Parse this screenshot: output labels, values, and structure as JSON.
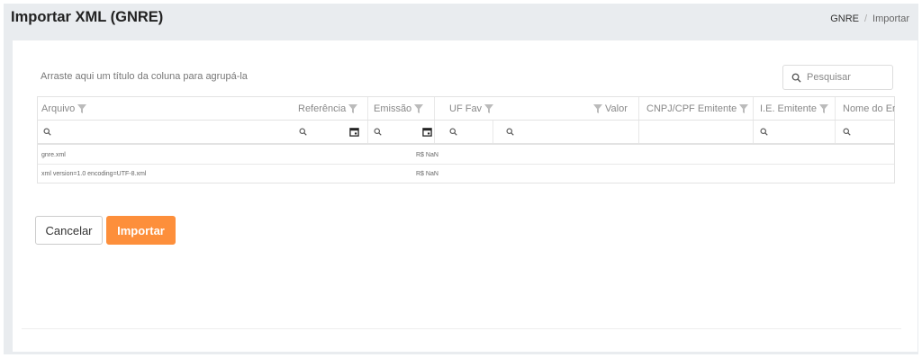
{
  "header": {
    "title": "Importar XML (GNRE)",
    "breadcrumb": [
      "GNRE",
      "Importar"
    ],
    "breadcrumb_separator": "/"
  },
  "grid": {
    "group_panel_text": "Arraste aqui um título da coluna para agrupá-la",
    "search_placeholder": "Pesquisar",
    "columns": [
      "Arquivo",
      "Referência",
      "Emissão",
      "UF Fav",
      "Valor",
      "CNPJ/CPF Emitente",
      "I.E. Emitente",
      "Nome do Emi"
    ],
    "rows": [
      {
        "arquivo": "gnre.xml",
        "valor": "R$ NaN"
      },
      {
        "arquivo": "xml version=1.0 encoding=UTF-8.xml",
        "valor": "R$ NaN"
      }
    ]
  },
  "actions": {
    "cancel_label": "Cancelar",
    "import_label": "Importar"
  },
  "colors": {
    "accent": "#fd8f3b",
    "frame_bg": "#e9ecef"
  },
  "icons": [
    "search-icon",
    "filter-icon",
    "calendar-icon"
  ]
}
